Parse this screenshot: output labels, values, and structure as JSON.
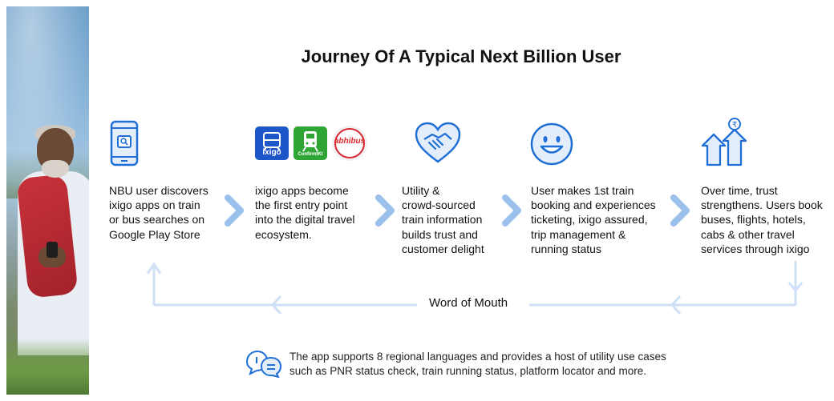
{
  "title": "Journey Of A Typical Next Billion User",
  "steps": [
    {
      "icon": "phone-search-icon",
      "lines": [
        "NBU user discovers",
        "ixigo apps on train",
        "or bus searches on",
        "Google Play Store"
      ]
    },
    {
      "icon": "app-logos",
      "lines": [
        "ixigo apps become",
        "the first entry point",
        "into the digital travel",
        "ecosystem."
      ]
    },
    {
      "icon": "heart-handshake-icon",
      "lines": [
        "Utility &",
        "crowd-sourced",
        "train information",
        "builds trust and",
        "customer delight"
      ]
    },
    {
      "icon": "smiley-icon",
      "lines": [
        "User makes 1st train",
        "booking and experiences",
        "ticketing, ixigo assured,",
        "trip management &",
        "running status"
      ]
    },
    {
      "icon": "growth-arrows-icon",
      "lines": [
        "Over time, trust",
        "strengthens. Users book",
        "buses, flights, hotels,",
        "cabs & other travel",
        "services through ixigo"
      ]
    }
  ],
  "logos": {
    "ixigo": "ixigo",
    "confirmtkt": "ConfirmtKt",
    "abhibus": "abhibus"
  },
  "word_of_mouth": "Word of Mouth",
  "note": {
    "line1": "The app supports 8 regional languages and provides a host of utility use cases",
    "line2": "such as PNR status check, train running status, platform locator and more."
  },
  "colors": {
    "accent": "#1f6fd6",
    "chevron": "#9cc0ec",
    "flow_line": "#cfe0f6",
    "icon_fill": "#e4eefb"
  }
}
